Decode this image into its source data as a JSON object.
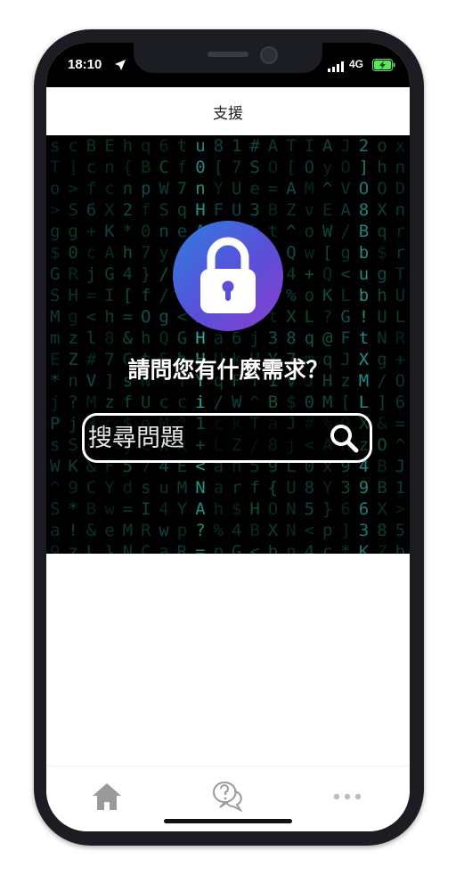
{
  "status_bar": {
    "time": "18:10",
    "network": "4G"
  },
  "nav": {
    "title": "支援"
  },
  "hero": {
    "question": "請問您有什麼需求？",
    "search_placeholder": "搜尋問題"
  },
  "tabbar": {
    "items": [
      "home-icon",
      "support-chat-icon",
      "more-icon"
    ]
  },
  "colors": {
    "matrix_text": "#1e8f86",
    "matrix_highlight": "#38d6c8",
    "lock_gradient_start": "#2f7de0",
    "lock_gradient_end": "#8a3fd0",
    "battery_green": "#5ee35e",
    "tab_icon": "#9a9a9a"
  }
}
